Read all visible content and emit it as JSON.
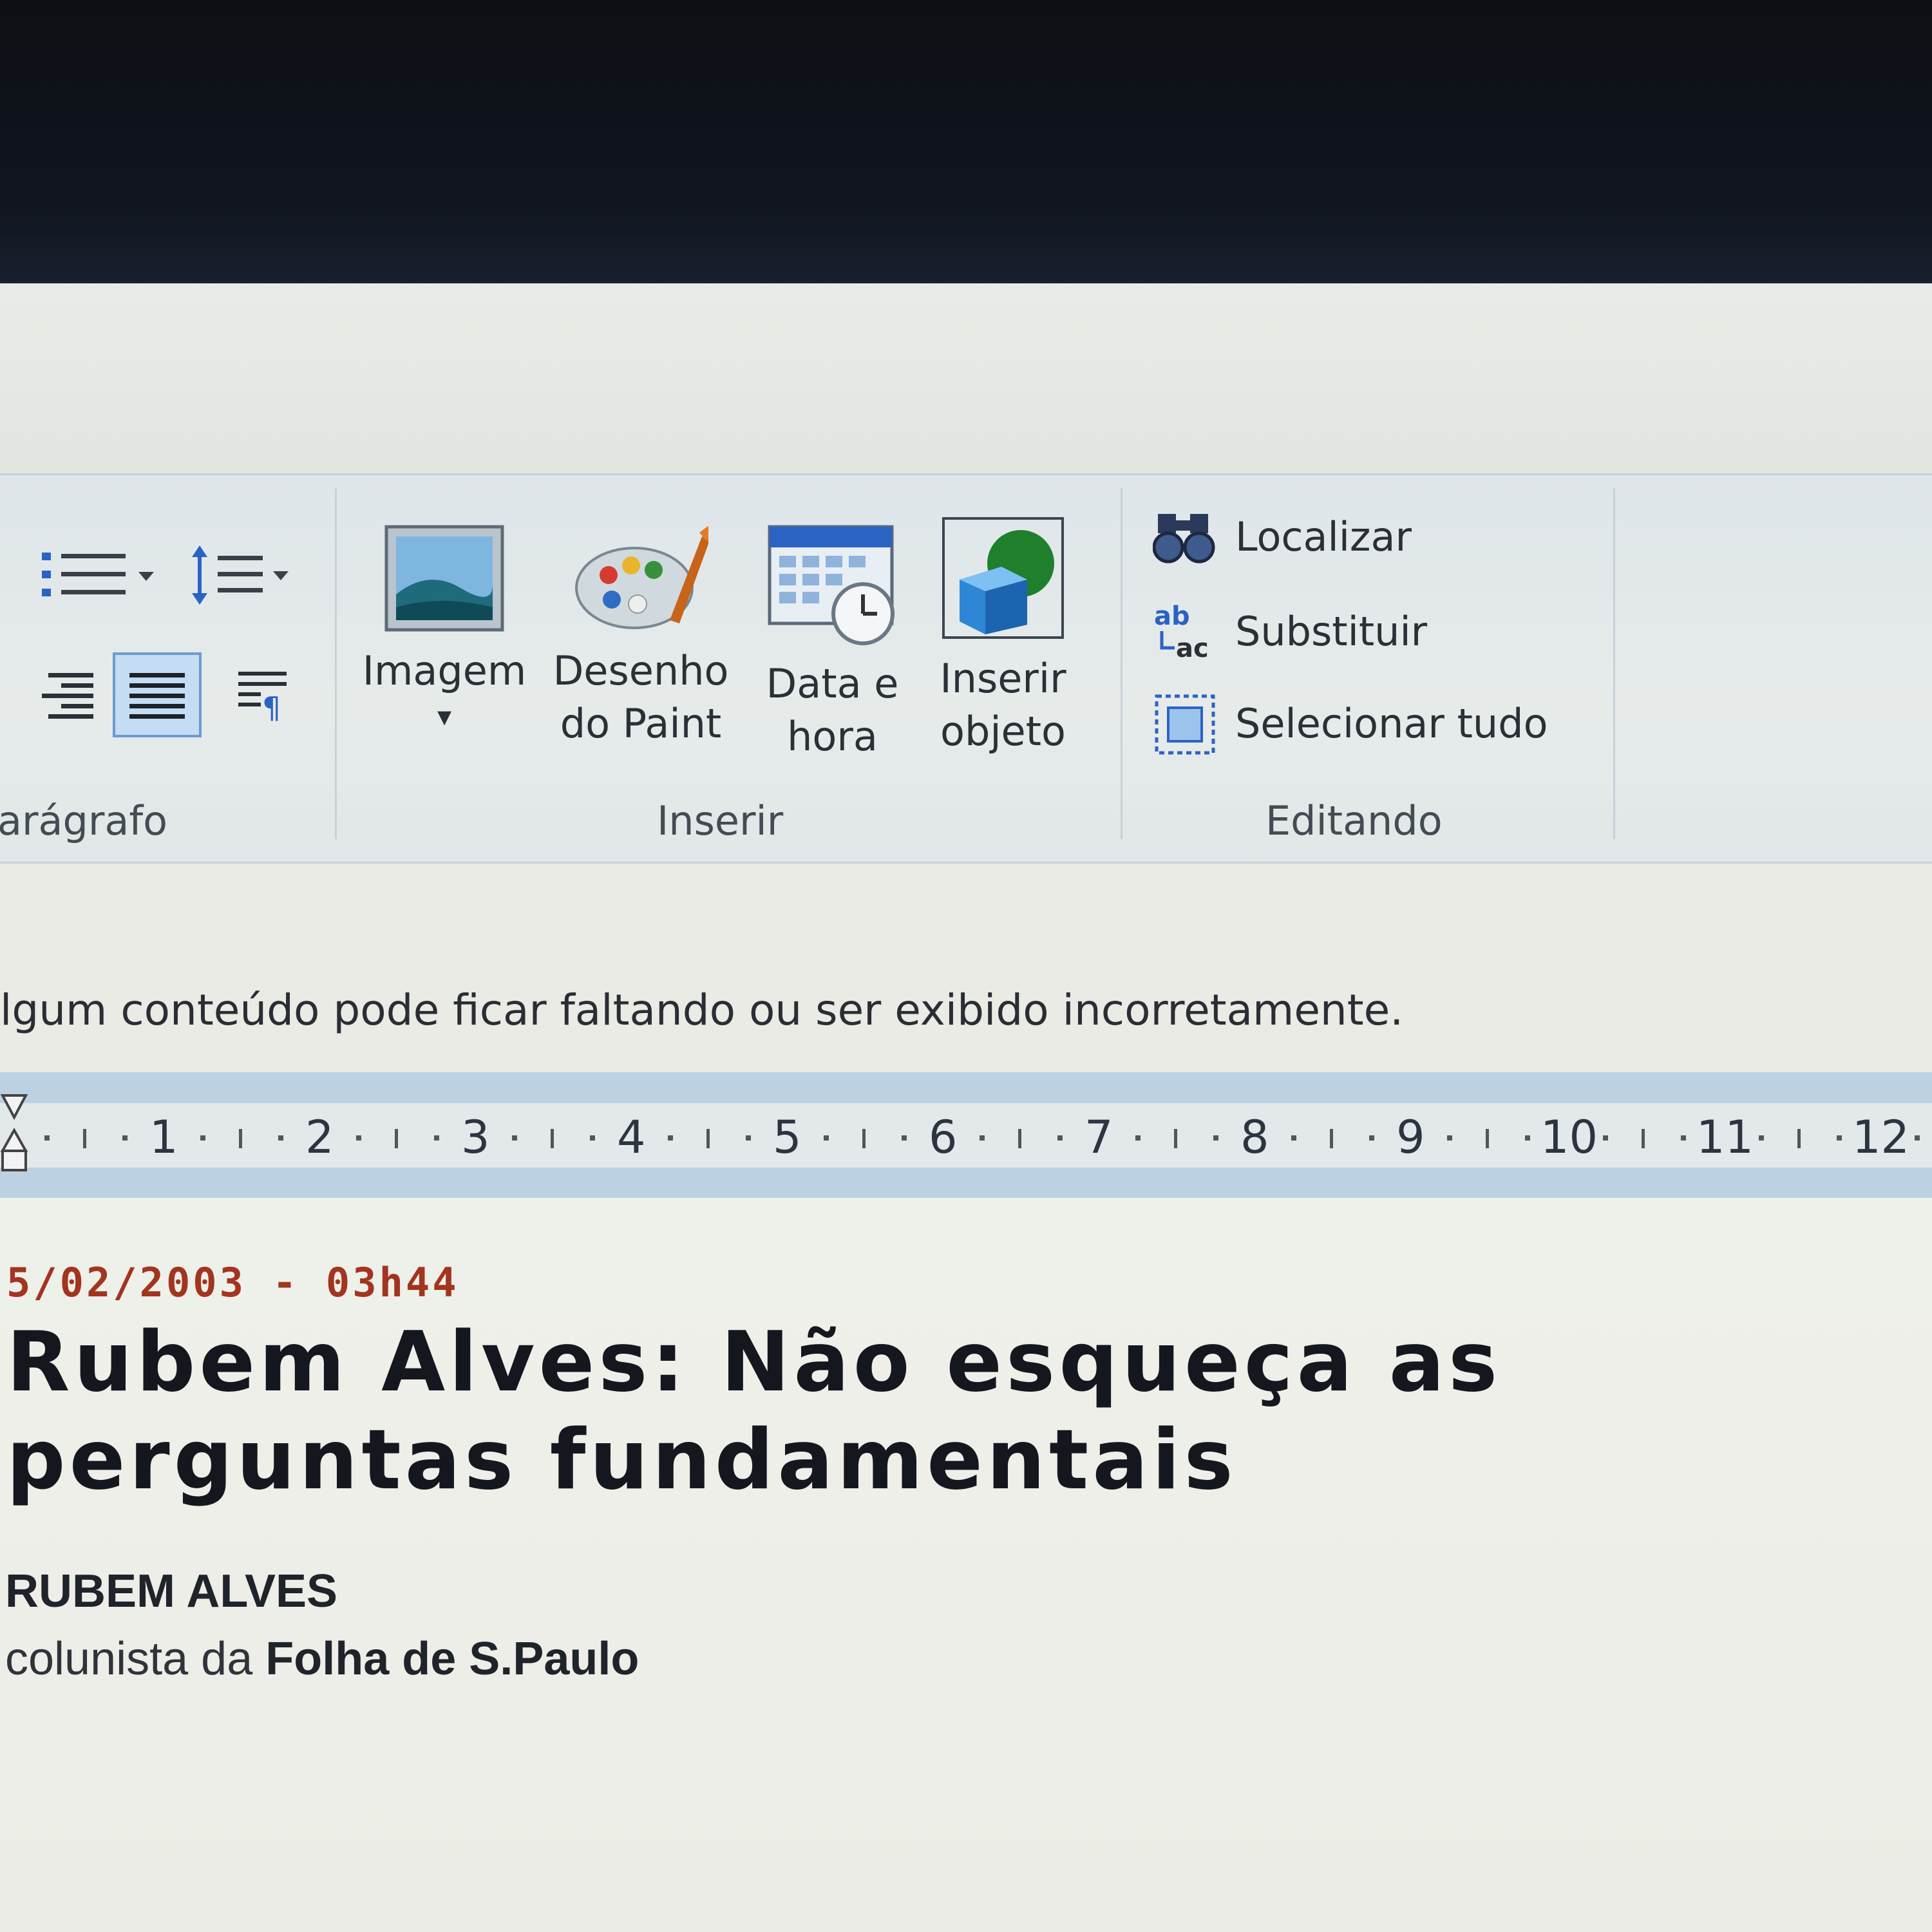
{
  "ribbon": {
    "paragraph_group_label": "arágrafo",
    "insert_group": {
      "label": "Inserir",
      "buttons": [
        {
          "line1": "Imagem",
          "line2": "▾",
          "icon": "picture-icon"
        },
        {
          "line1": "Desenho",
          "line2": "do Paint",
          "icon": "paint-palette-icon"
        },
        {
          "line1": "Data e",
          "line2": "hora",
          "icon": "calendar-clock-icon"
        },
        {
          "line1": "Inserir",
          "line2": "objeto",
          "icon": "object-icon"
        }
      ]
    },
    "editing_group": {
      "label": "Editando",
      "find": "Localizar",
      "replace": "Substituir",
      "select_all": "Selecionar tudo",
      "replace_icon_text": "ab ac"
    }
  },
  "warning": "lgum conteúdo pode ficar faltando ou ser exibido incorretamente.",
  "ruler": {
    "numbers": [
      "1",
      "2",
      "3",
      "4",
      "5",
      "6",
      "7",
      "8",
      "9",
      "10",
      "11",
      "12"
    ]
  },
  "document": {
    "dateline": "5/02/2003 - 03h44",
    "headline": "Rubem Alves: Não esqueça as perguntas fundamentais",
    "author": "RUBEM ALVES",
    "byline_prefix": "colunista da ",
    "byline_paper": "Folha de S.Paulo"
  },
  "colors": {
    "dateline": "#a3341f",
    "ribbon_bg": "#dfe6ea",
    "ruler_bg": "#bcd2e2"
  }
}
